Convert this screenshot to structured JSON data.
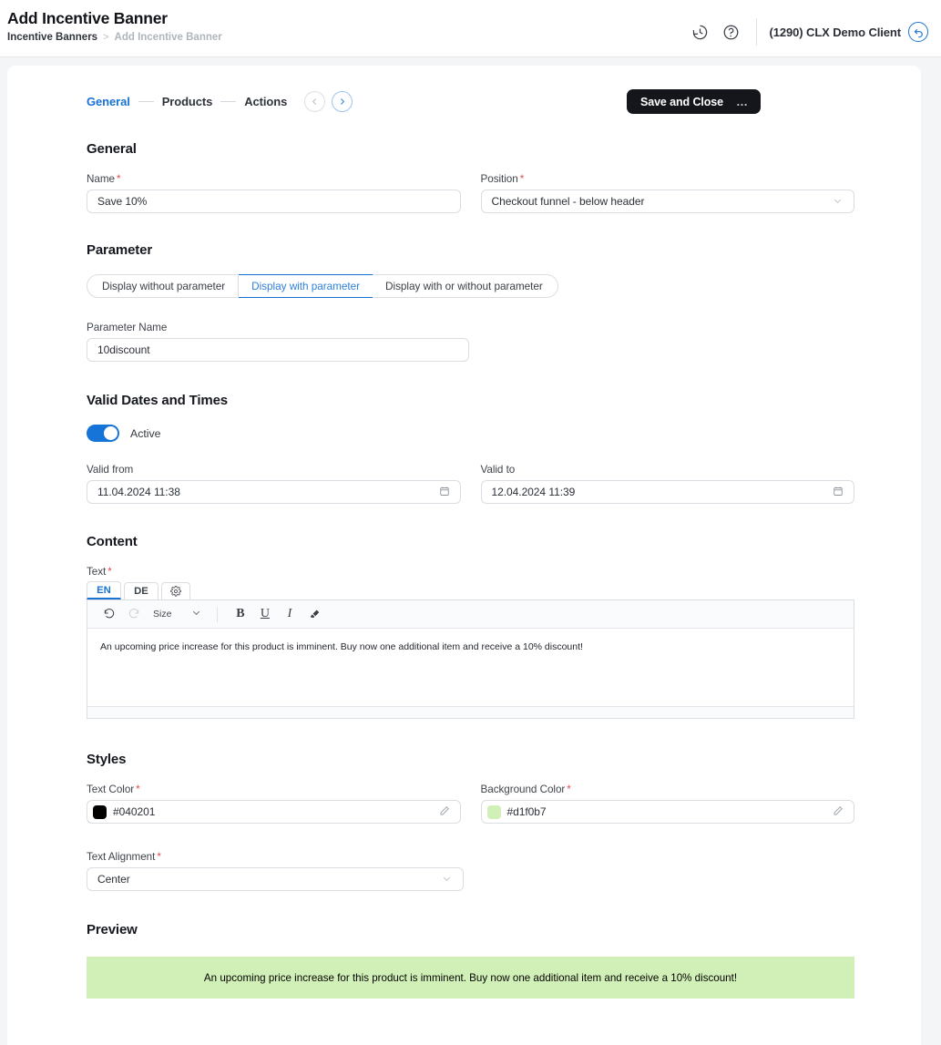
{
  "header": {
    "title": "Add Incentive Banner",
    "breadcrumb": {
      "parent": "Incentive Banners",
      "separator": ">",
      "current": "Add Incentive Banner"
    },
    "history_icon": "clock-history-icon",
    "help_icon": "help-circle-icon",
    "client": "(1290) CLX Demo Client",
    "client_back_icon": "undo-arrow-icon"
  },
  "wizard": {
    "steps": [
      {
        "label": "General",
        "active": true
      },
      {
        "label": "Products",
        "active": false
      },
      {
        "label": "Actions",
        "active": false
      }
    ],
    "prev_icon": "chevron-left-icon",
    "next_icon": "chevron-right-icon",
    "save_label": "Save and Close",
    "more_label": "…"
  },
  "general": {
    "section_title": "General",
    "name_label": "Name",
    "name_value": "Save 10%",
    "position_label": "Position",
    "position_value": "Checkout funnel - below header",
    "required_marker": "*"
  },
  "parameter": {
    "section_title": "Parameter",
    "options": [
      {
        "label": "Display without parameter",
        "selected": false
      },
      {
        "label": "Display with parameter",
        "selected": true
      },
      {
        "label": "Display with or without parameter",
        "selected": false
      }
    ],
    "name_label": "Parameter Name",
    "name_value": "10discount"
  },
  "validity": {
    "section_title": "Valid Dates and Times",
    "active_label": "Active",
    "active_on": true,
    "valid_from_label": "Valid from",
    "valid_from_value": "11.04.2024 11:38",
    "valid_to_label": "Valid to",
    "valid_to_value": "12.04.2024 11:39",
    "calendar_icon": "calendar-icon"
  },
  "content": {
    "section_title": "Content",
    "text_label": "Text",
    "lang_tabs": [
      {
        "label": "EN",
        "active": true
      },
      {
        "label": "DE",
        "active": false
      }
    ],
    "settings_tab_icon": "gear-icon",
    "toolbar": {
      "undo_icon": "undo-icon",
      "redo_icon": "redo-icon",
      "size_label": "Size",
      "size_chevron_icon": "chevron-down-icon",
      "bold_label": "B",
      "underline_label": "U",
      "italic_label": "I",
      "eraser_icon": "eraser-icon"
    },
    "body_text": "An upcoming price increase for this product is imminent. Buy now one additional item and receive a 10% discount!"
  },
  "styles": {
    "section_title": "Styles",
    "text_color_label": "Text Color",
    "text_color_value": "#040201",
    "background_color_label": "Background Color",
    "background_color_value": "#d1f0b7",
    "pencil_icon": "pencil-icon",
    "alignment_label": "Text Alignment",
    "alignment_value": "Center"
  },
  "preview": {
    "section_title": "Preview",
    "text": "An upcoming price increase for this product is imminent. Buy now one additional item and receive a 10% discount!",
    "background": "#d1f0b7",
    "color": "#040201"
  },
  "theme": {
    "accent": "#1a73d4",
    "dark": "#14161c",
    "required": "#e24d4d"
  }
}
